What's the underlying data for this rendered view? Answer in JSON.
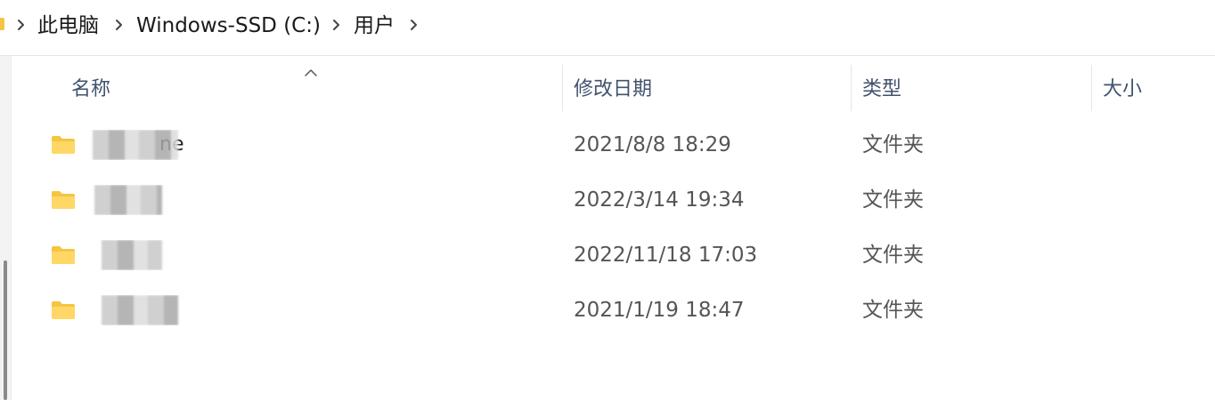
{
  "breadcrumb": {
    "items": [
      {
        "label": "此电脑"
      },
      {
        "label": "Windows-SSD (C:)"
      },
      {
        "label": "用户"
      }
    ]
  },
  "columns": {
    "name": "名称",
    "modified": "修改日期",
    "type": "类型",
    "size": "大小"
  },
  "sort": {
    "column": "名称",
    "direction": "ascending"
  },
  "rows": [
    {
      "name_visible": "ne",
      "modified": "2021/8/8 18:29",
      "type": "文件夹",
      "size": ""
    },
    {
      "name_visible": "",
      "modified": "2022/3/14 19:34",
      "type": "文件夹",
      "size": ""
    },
    {
      "name_visible": "",
      "modified": "2022/11/18 17:03",
      "type": "文件夹",
      "size": ""
    },
    {
      "name_visible": "",
      "modified": "2021/1/19 18:47",
      "type": "文件夹",
      "size": ""
    }
  ],
  "icons": {
    "breadcrumb_separator": "chevron-right-icon",
    "row_icon": "folder-icon",
    "sort_indicator": "sort-ascending-icon"
  },
  "colors": {
    "folder": "#f5c542",
    "header_text": "#42526e",
    "cell_text": "#555555"
  }
}
